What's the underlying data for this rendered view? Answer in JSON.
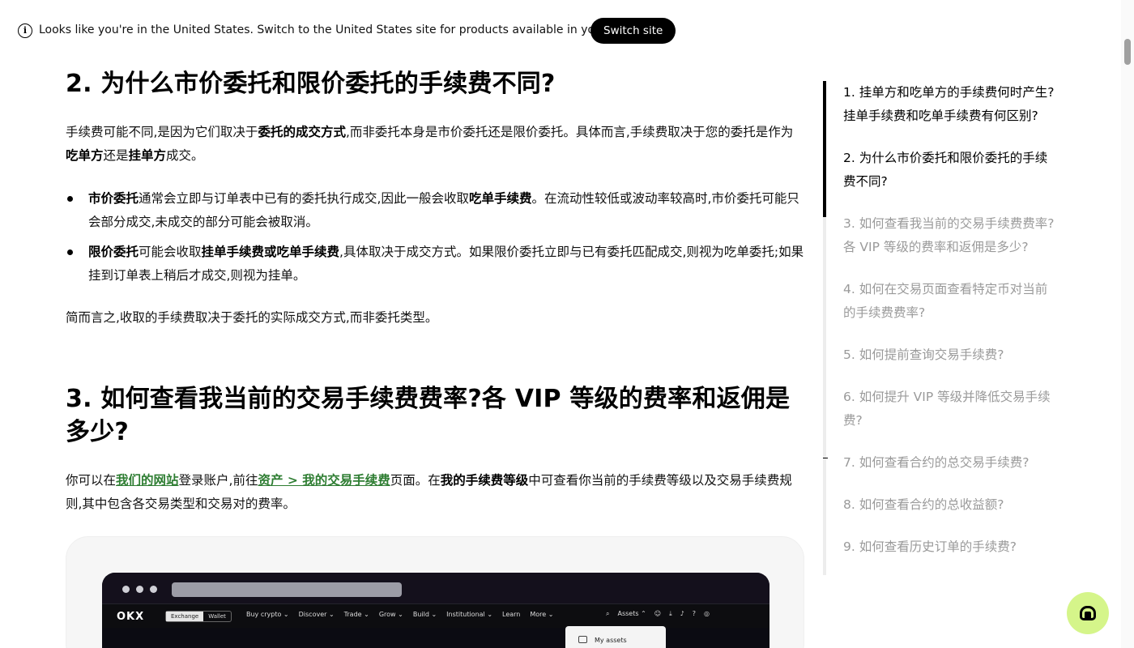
{
  "banner": {
    "info_icon": "info-circle-icon",
    "text": "Looks like you're in the United States. Switch to the United States site for products available in your region.",
    "switch_label": "Switch site"
  },
  "section2": {
    "title": "2. 为什么市价委托和限价委托的手续费不同?",
    "p1": {
      "t1": "手续费可能不同,是因为它们取决于",
      "b1": "委托的成交方式",
      "t2": ",而非委托本身是市价委托还是限价委托。具体而言,手续费取决于您的委托是作为",
      "b2": "吃单方",
      "t3": "还是",
      "b3": "挂单方",
      "t4": "成交。"
    },
    "bullets": [
      {
        "b1": "市价委托",
        "t1": "通常会立即与订单表中已有的委托执行成交,因此一般会收取",
        "b2": "吃单手续费",
        "t2": "。在流动性较低或波动率较高时,市价委托可能只会部分成交,未成交的部分可能会被取消。"
      },
      {
        "b1": "限价委托",
        "t1": "可能会收取",
        "b2": "挂单手续费或吃单手续费",
        "t2": ",具体取决于成交方式。如果限价委托立即与已有委托匹配成交,则视为吃单委托;如果挂到订单表上稍后才成交,则视为挂单。"
      }
    ],
    "p2": "简而言之,收取的手续费取决于委托的实际成交方式,而非委托类型。"
  },
  "section3": {
    "title": "3. 如何查看我当前的交易手续费费率?各 VIP 等级的费率和返佣是多少?",
    "p1": {
      "t1": "你可以在",
      "link1": "我们的网站",
      "t2": "登录账户,前往",
      "link2": "资产 > 我的交易手续费",
      "t3": "页面。在",
      "b1": "我的手续费等级",
      "t4": "中可查看你当前的手续费等级以及交易手续费规则,其中包含各交易类型和交易对的费率。"
    }
  },
  "mockup": {
    "logo": "OKX",
    "seg_exchange": "Exchange",
    "seg_wallet": "Wallet",
    "menu": [
      "Buy crypto ⌄",
      "Discover ⌄",
      "Trade ⌄",
      "Grow ⌄",
      "Build ⌄",
      "Institutional ⌄",
      "Learn",
      "More ⌄"
    ],
    "assets_label": "Assets ⌃",
    "dropdown_item": "My assets"
  },
  "toc": {
    "items": [
      "1. 挂单方和吃单方的手续费何时产生?挂单手续费和吃单手续费有何区别?",
      "2. 为什么市价委托和限价委托的手续费不同?",
      "3. 如何查看我当前的交易手续费费率?各 VIP 等级的费率和返佣是多少?",
      "4. 如何在交易页面查看特定币对当前的手续费费率?",
      "5. 如何提前查询交易手续费?",
      "6. 如何提升 VIP 等级并降低交易手续费?",
      "7. 如何查看合约的总交易手续费?",
      "8. 如何查看合约的总收益额?",
      "9. 如何查看历史订单的手续费?"
    ]
  },
  "support": {
    "icon": "headset-icon"
  }
}
